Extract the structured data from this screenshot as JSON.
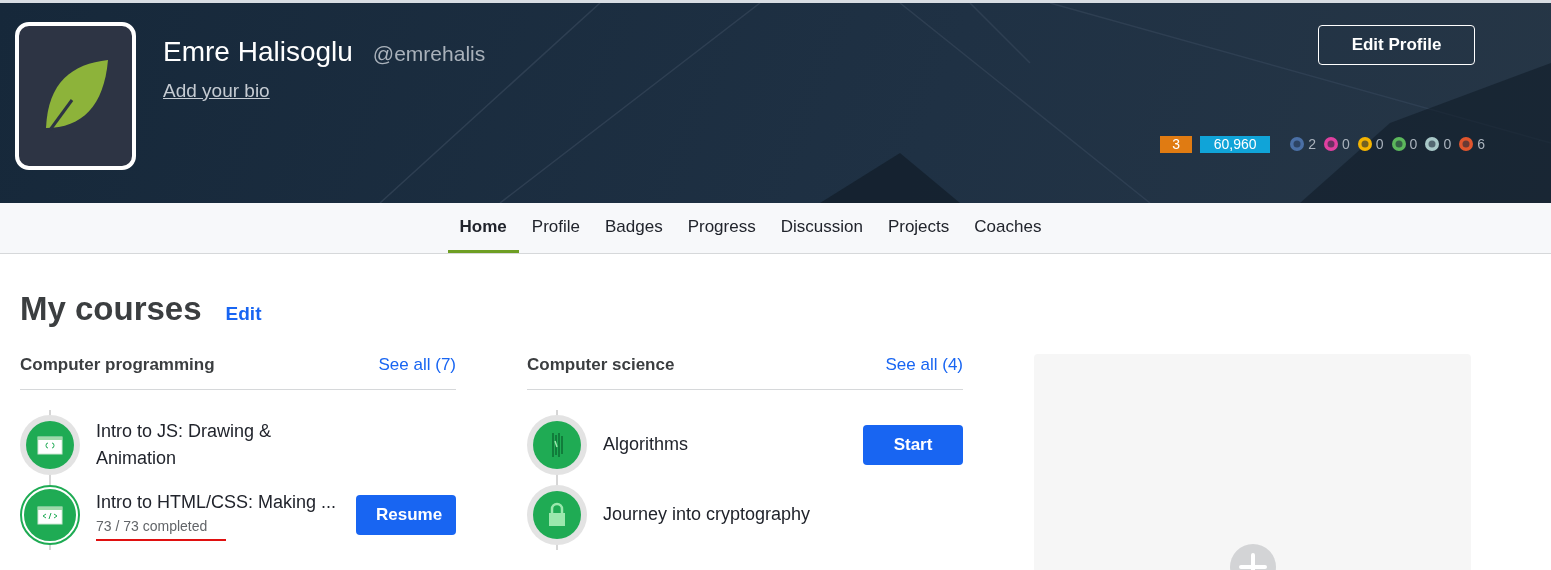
{
  "profile": {
    "name": "Emre Halisoglu",
    "username": "@emrehalis",
    "bio_link": "Add your bio",
    "edit_button": "Edit Profile"
  },
  "stats": {
    "level": "3",
    "points": "60,960"
  },
  "badges": [
    {
      "count": "2",
      "color": "#4a6fa5"
    },
    {
      "count": "0",
      "color": "#e040a0"
    },
    {
      "count": "0",
      "color": "#f5b400"
    },
    {
      "count": "0",
      "color": "#5cb85c"
    },
    {
      "count": "0",
      "color": "#a8c8c8"
    },
    {
      "count": "6",
      "color": "#e0552d"
    }
  ],
  "tabs": [
    {
      "label": "Home",
      "selected": true
    },
    {
      "label": "Profile",
      "selected": false
    },
    {
      "label": "Badges",
      "selected": false
    },
    {
      "label": "Progress",
      "selected": false
    },
    {
      "label": "Discussion",
      "selected": false
    },
    {
      "label": "Projects",
      "selected": false
    },
    {
      "label": "Coaches",
      "selected": false
    }
  ],
  "page_title": "My courses",
  "edit_link": "Edit",
  "course_groups": [
    {
      "title": "Computer programming",
      "see_all": "See all (7)",
      "courses": [
        {
          "kind": "braces",
          "title": "Intro to JS: Drawing & Animation",
          "active": false
        },
        {
          "kind": "tag",
          "title": "Intro to HTML/CSS: Making ...",
          "progress": "73 / 73 completed",
          "button": "Resume",
          "active": true
        }
      ]
    },
    {
      "title": "Computer science",
      "see_all": "See all (4)",
      "courses": [
        {
          "kind": "algorithm",
          "title": "Algorithms",
          "button": "Start",
          "active": false
        },
        {
          "kind": "lock",
          "title": "Journey into cryptography",
          "active": false
        }
      ]
    }
  ]
}
